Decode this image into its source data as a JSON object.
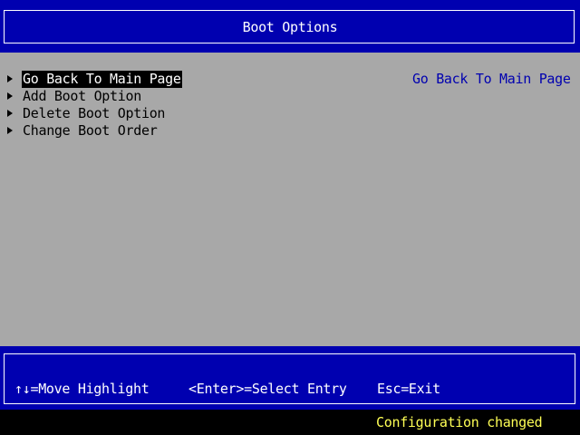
{
  "header": {
    "title": "Boot Options"
  },
  "menu": {
    "items": [
      {
        "label": "Go Back To Main Page",
        "selected": true
      },
      {
        "label": "Add Boot Option",
        "selected": false
      },
      {
        "label": "Delete Boot Option",
        "selected": false
      },
      {
        "label": "Change Boot Order",
        "selected": false
      }
    ]
  },
  "help": {
    "text": "Go Back To Main Page"
  },
  "footer": {
    "hints": [
      "↑↓=Move Highlight",
      "<Enter>=Select Entry",
      "Esc=Exit"
    ]
  },
  "status": {
    "text": "Configuration changed"
  },
  "colors": {
    "band": "#0000b0",
    "panel": "#a8a8a8",
    "highlight_bg": "#000000",
    "highlight_fg": "#ffffff",
    "help_text": "#0000b0",
    "status_text": "#ffff55"
  }
}
